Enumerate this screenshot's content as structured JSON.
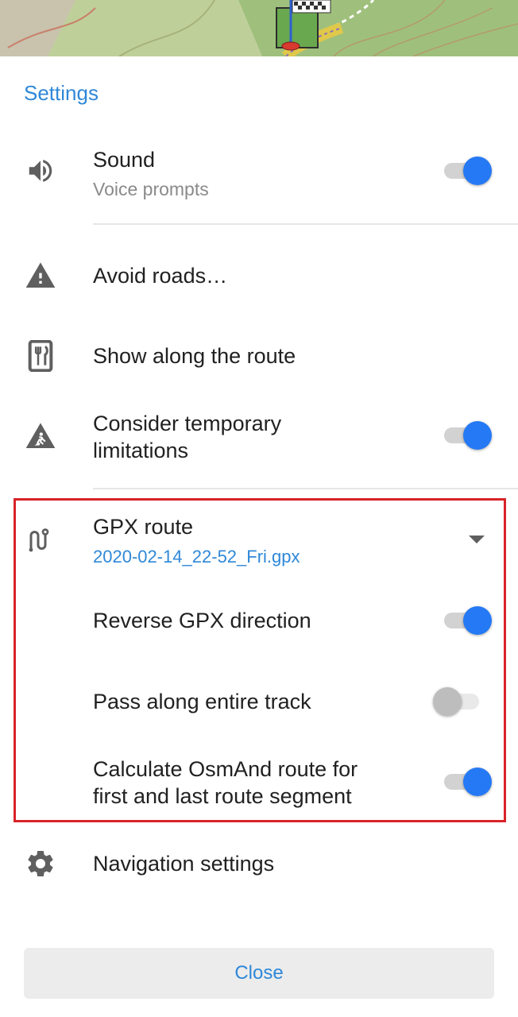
{
  "section_title": "Settings",
  "colors": {
    "accent": "#2f88d8",
    "switch_on": "#2579f4",
    "highlight_border": "#d8232a",
    "icon_gray": "#5f5f5f"
  },
  "items": {
    "sound": {
      "icon": "speaker-icon",
      "title": "Sound",
      "subtitle": "Voice prompts",
      "enabled": true
    },
    "avoid_roads": {
      "icon": "warning-icon",
      "title": "Avoid roads…"
    },
    "show_along": {
      "icon": "restaurant-icon",
      "title": "Show along the route"
    },
    "temporary_limitations": {
      "icon": "roadworks-icon",
      "title": "Consider temporary limitations",
      "title_line1": "Consider temporary",
      "title_line2": "limitations",
      "enabled": true
    },
    "gpx_route": {
      "icon": "route-icon",
      "title": "GPX route",
      "file": "2020-02-14_22-52_Fri.gpx"
    },
    "reverse_gpx": {
      "title": "Reverse GPX direction",
      "enabled": true
    },
    "pass_entire_track": {
      "title": "Pass along entire track",
      "enabled": false
    },
    "calculate_osmand": {
      "title_line1": "Calculate OsmAnd route for",
      "title_line2": "first and last route segment",
      "enabled": true
    },
    "navigation_settings": {
      "icon": "gear-icon",
      "title": "Navigation settings"
    }
  },
  "close_label": "Close"
}
